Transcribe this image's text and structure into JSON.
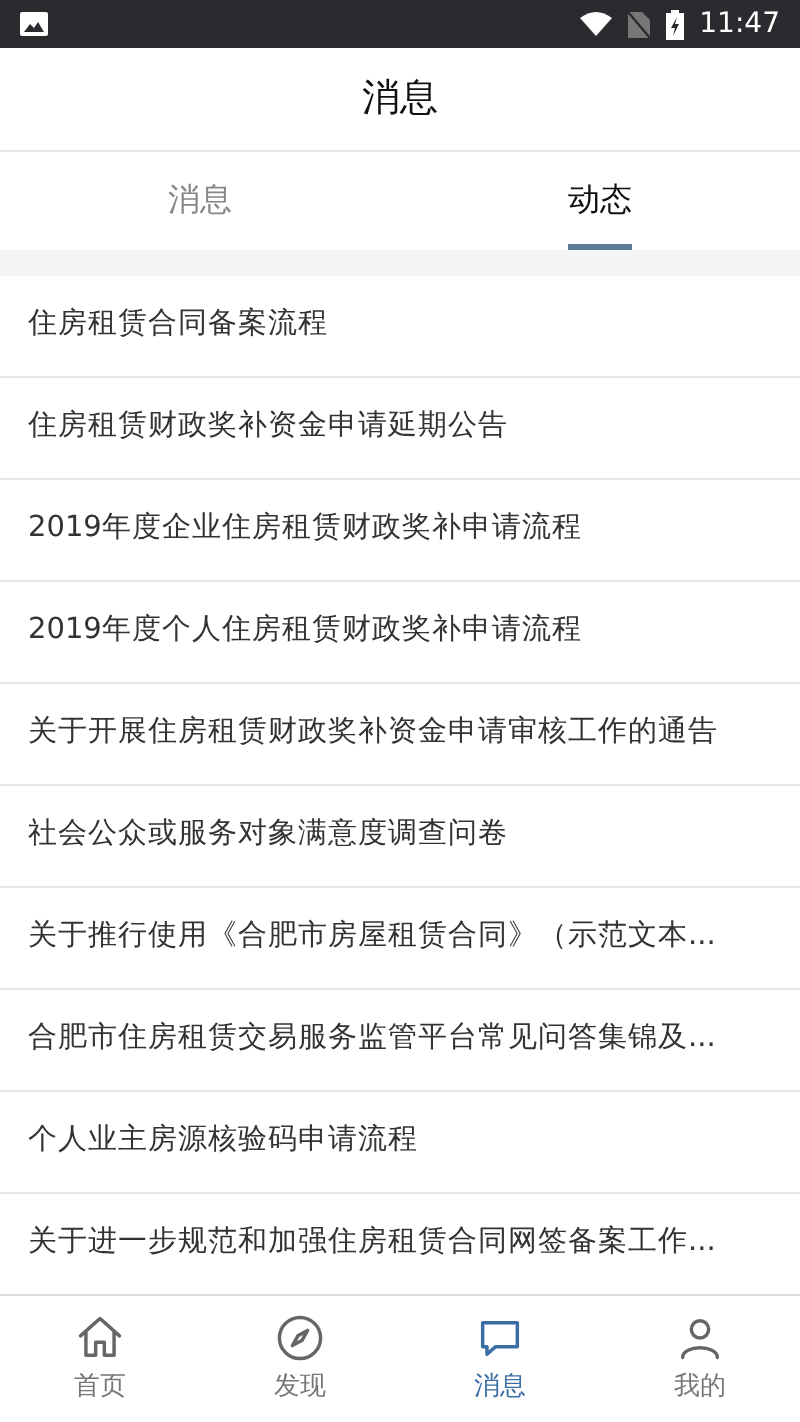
{
  "status_bar": {
    "time": "11:47"
  },
  "header": {
    "title": "消息"
  },
  "tabs": [
    {
      "label": "消息",
      "selected": false
    },
    {
      "label": "动态",
      "selected": true
    }
  ],
  "items": [
    "住房租赁合同备案流程",
    "住房租赁财政奖补资金申请延期公告",
    "2019年度企业住房租赁财政奖补申请流程",
    "2019年度个人住房租赁财政奖补申请流程",
    "关于开展住房租赁财政奖补资金申请审核工作的通告",
    "社会公众或服务对象满意度调查问卷",
    "关于推行使用《合肥市房屋租赁合同》（示范文本...",
    "合肥市住房租赁交易服务监管平台常见问答集锦及...",
    "个人业主房源核验码申请流程",
    "关于进一步规范和加强住房租赁合同网签备案工作..."
  ],
  "bottom_nav": [
    {
      "label": "首页",
      "kind": "home",
      "selected": false
    },
    {
      "label": "发现",
      "kind": "compass",
      "selected": false
    },
    {
      "label": "消息",
      "kind": "chat",
      "selected": true
    },
    {
      "label": "我的",
      "kind": "person",
      "selected": false
    }
  ]
}
